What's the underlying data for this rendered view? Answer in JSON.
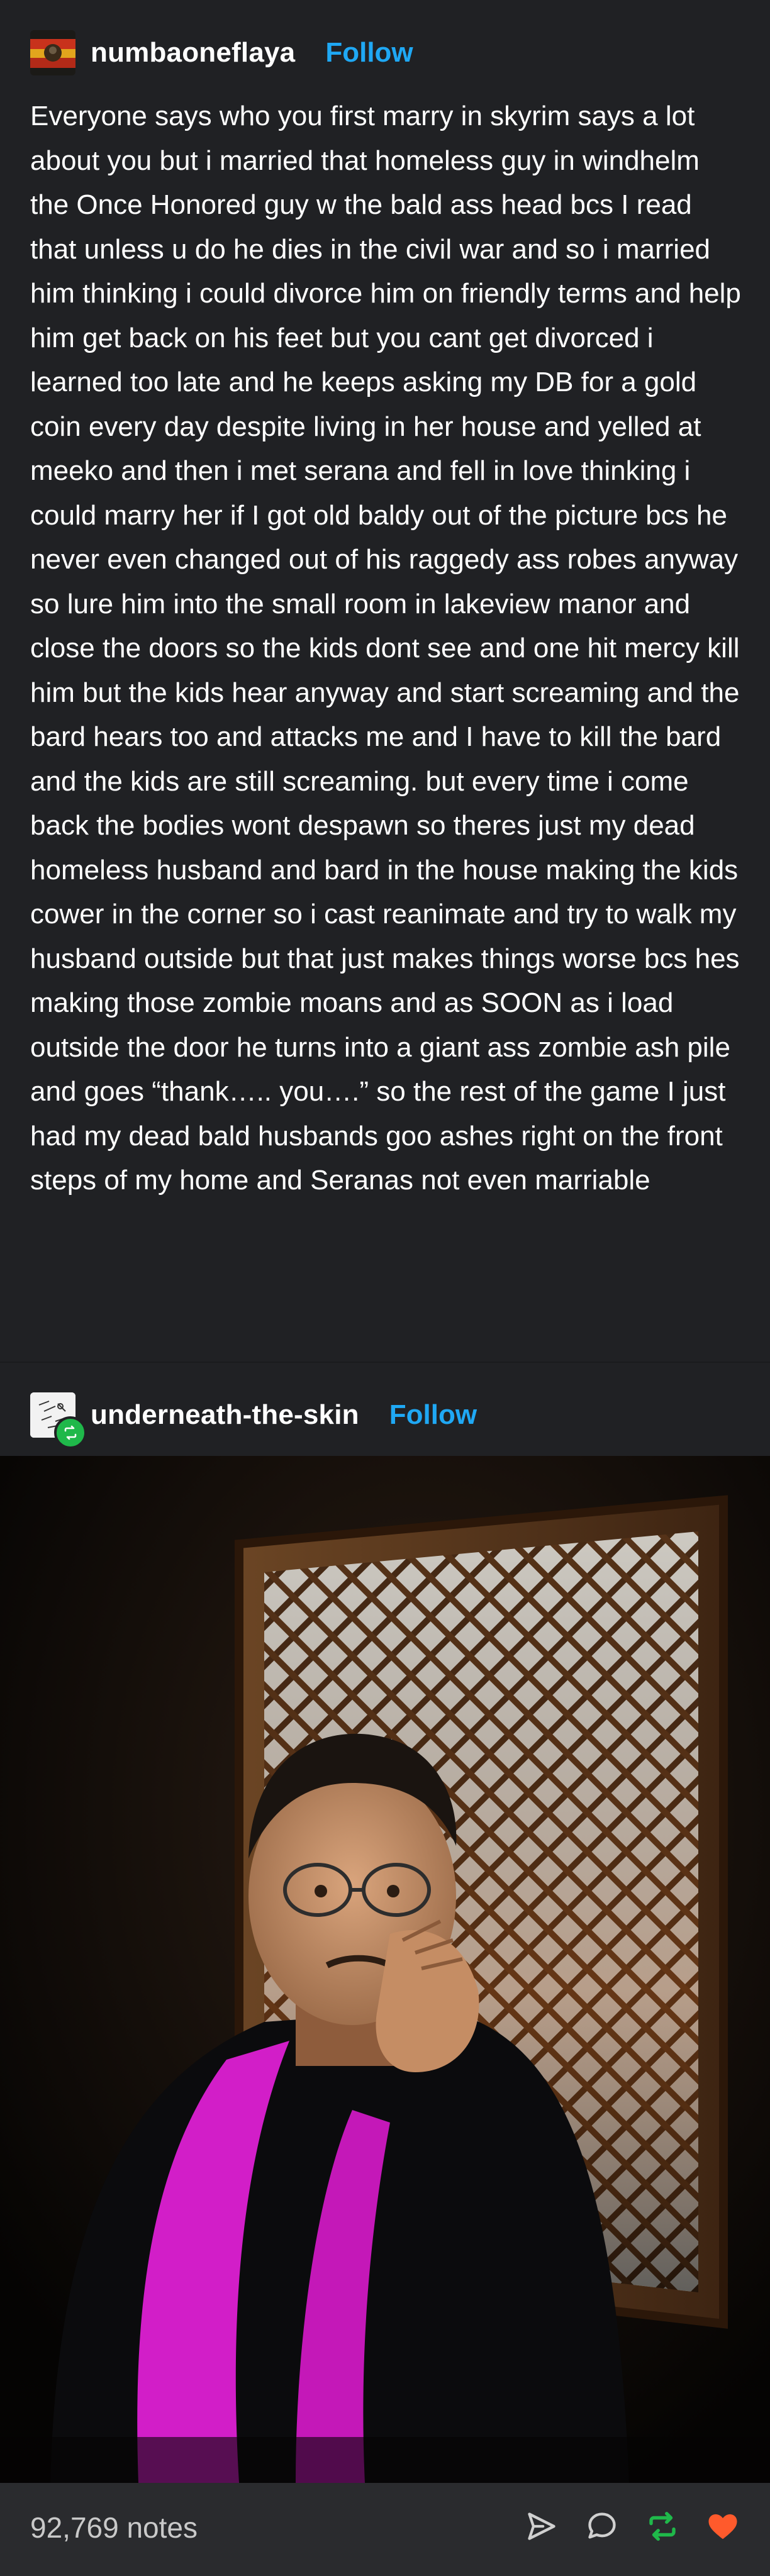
{
  "post": {
    "username": "numbaoneflaya",
    "follow_label": "Follow",
    "avatar_icon": "flag-avatar-icon",
    "body": "Everyone says who you first marry in skyrim says a lot about you but i married that homeless guy in windhelm the Once Honored guy w the bald ass head bcs I read that unless u do he dies in the civil war and so i married him thinking i could divorce him on friendly terms and help him get back on his feet  but you cant get divorced i learned too late and he keeps asking my DB for a gold coin every day despite living in her house and yelled at meeko and then i met serana and fell in love thinking i could marry her if I got old baldy out of the picture bcs he never even changed out of his raggedy ass robes anyway so lure him into the small room in lakeview manor and close the doors so the kids dont see and one hit mercy kill him but the kids hear anyway and start screaming and the bard hears too and attacks me and I have to kill the bard and the kids are still screaming. but every time i come back the bodies wont despawn so theres just my dead homeless husband and bard in the house making the kids cower in the corner so i cast reanimate and try to walk my husband outside but that just makes things worse bcs hes making those zombie moans and as SOON as i load outside the door he turns into a giant ass zombie ash pile and goes “thank….. you….” so the rest of the game I just had my dead bald husbands goo ashes right on the front steps of my home and Seranas not even marriable"
  },
  "reblog": {
    "username": "underneath-the-skin",
    "follow_label": "Follow",
    "avatar_icon": "sketch-avatar-icon",
    "badge_icon": "reblog-badge-icon",
    "photo_icon": "priest-photo-icon"
  },
  "footer": {
    "notes": "92,769 notes",
    "icons": [
      "share-icon",
      "reply-icon",
      "reblog-icon",
      "like-icon"
    ]
  },
  "colors": {
    "background": "#202124",
    "accent": "#1fa8f4",
    "reblog_green": "#1fb84a",
    "like_red": "#ff5a2c",
    "footer_bg": "#2a2b2e"
  }
}
